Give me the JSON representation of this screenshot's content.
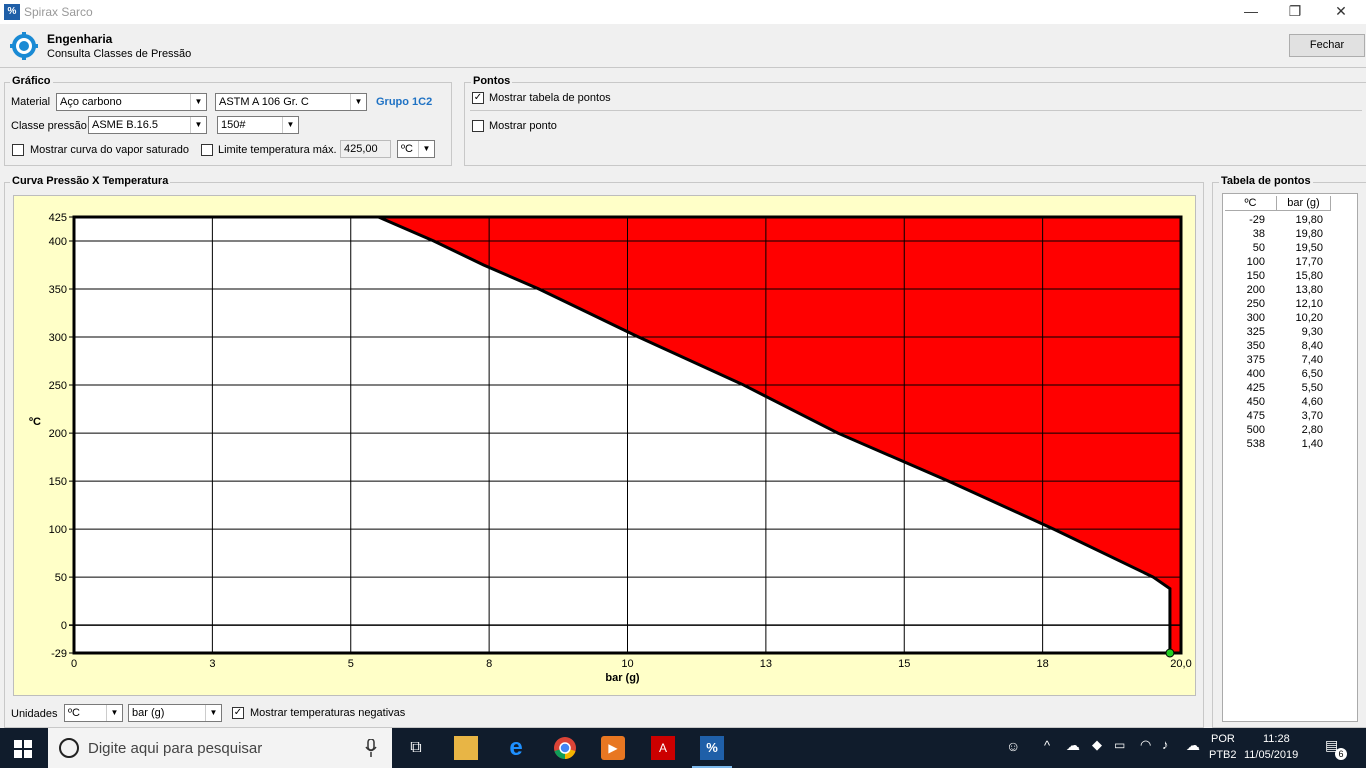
{
  "window": {
    "title": "Spirax Sarco",
    "app_icon": "%",
    "minimize": "—",
    "restore": "❐",
    "close": "✕"
  },
  "header": {
    "title": "Engenharia",
    "subtitle": "Consulta Classes de Pressão",
    "close_button": "Fechar"
  },
  "grafico": {
    "label": "Gráfico",
    "material_label": "Material",
    "material_value": "Aço carbono",
    "spec_value": "ASTM A 106 Gr. C",
    "group_label": "Grupo 1C2",
    "classe_label": "Classe pressão",
    "classe_value": "ASME B.16.5",
    "rating_value": "150#",
    "vapor_label": "Mostrar curva do vapor saturado",
    "vapor_checked": false,
    "limit_label": "Limite temperatura máx.",
    "limit_checked": false,
    "limit_value": "425,00",
    "limit_unit": "ºC"
  },
  "pontos": {
    "label": "Pontos",
    "tabela_label": "Mostrar tabela de pontos",
    "tabela_checked": true,
    "ponto_label": "Mostrar ponto",
    "ponto_checked": false
  },
  "curva": {
    "label": "Curva Pressão X Temperatura"
  },
  "units": {
    "label": "Unidades",
    "temp_unit": "ºC",
    "press_unit": "bar (g)",
    "neg_label": "Mostrar temperaturas negativas",
    "neg_checked": true
  },
  "chart_data": {
    "type": "area",
    "ylabel": "ºC",
    "xlabel": "bar (g)",
    "xlim": [
      0,
      20
    ],
    "ylim": [
      -29,
      425
    ],
    "x_ticks": [
      "0",
      "3",
      "5",
      "8",
      "10",
      "13",
      "15",
      "18",
      "20,0"
    ],
    "x_tick_values": [
      0,
      2.5,
      5,
      7.5,
      10,
      12.5,
      15,
      17.5,
      20
    ],
    "y_ticks": [
      425,
      400,
      350,
      300,
      250,
      200,
      150,
      100,
      50,
      0,
      -29
    ],
    "grid": true,
    "fill_color": "#ff0000",
    "line_color": "#000000",
    "marker_color": "#22cc22",
    "points": [
      {
        "t": -29,
        "p": 19.8
      },
      {
        "t": 38,
        "p": 19.8
      },
      {
        "t": 50,
        "p": 19.5
      },
      {
        "t": 100,
        "p": 17.7
      },
      {
        "t": 150,
        "p": 15.8
      },
      {
        "t": 200,
        "p": 13.8
      },
      {
        "t": 250,
        "p": 12.1
      },
      {
        "t": 300,
        "p": 10.2
      },
      {
        "t": 325,
        "p": 9.3
      },
      {
        "t": 350,
        "p": 8.4
      },
      {
        "t": 375,
        "p": 7.4
      },
      {
        "t": 400,
        "p": 6.5
      },
      {
        "t": 425,
        "p": 5.5
      }
    ],
    "marker": {
      "t": -29,
      "p": 19.8
    }
  },
  "tabela": {
    "label": "Tabela de pontos",
    "col_temp": "ºC",
    "col_press": "bar (g)",
    "rows": [
      [
        "-29",
        "19,80"
      ],
      [
        "38",
        "19,80"
      ],
      [
        "50",
        "19,50"
      ],
      [
        "100",
        "17,70"
      ],
      [
        "150",
        "15,80"
      ],
      [
        "200",
        "13,80"
      ],
      [
        "250",
        "12,10"
      ],
      [
        "300",
        "10,20"
      ],
      [
        "325",
        "9,30"
      ],
      [
        "350",
        "8,40"
      ],
      [
        "375",
        "7,40"
      ],
      [
        "400",
        "6,50"
      ],
      [
        "425",
        "5,50"
      ],
      [
        "450",
        "4,60"
      ],
      [
        "475",
        "3,70"
      ],
      [
        "500",
        "2,80"
      ],
      [
        "538",
        "1,40"
      ]
    ]
  },
  "taskbar": {
    "search_placeholder": "Digite aqui para pesquisar",
    "lang1": "POR",
    "lang2": "PTB2",
    "time": "11:28",
    "date": "11/05/2019",
    "notif_count": "6"
  }
}
